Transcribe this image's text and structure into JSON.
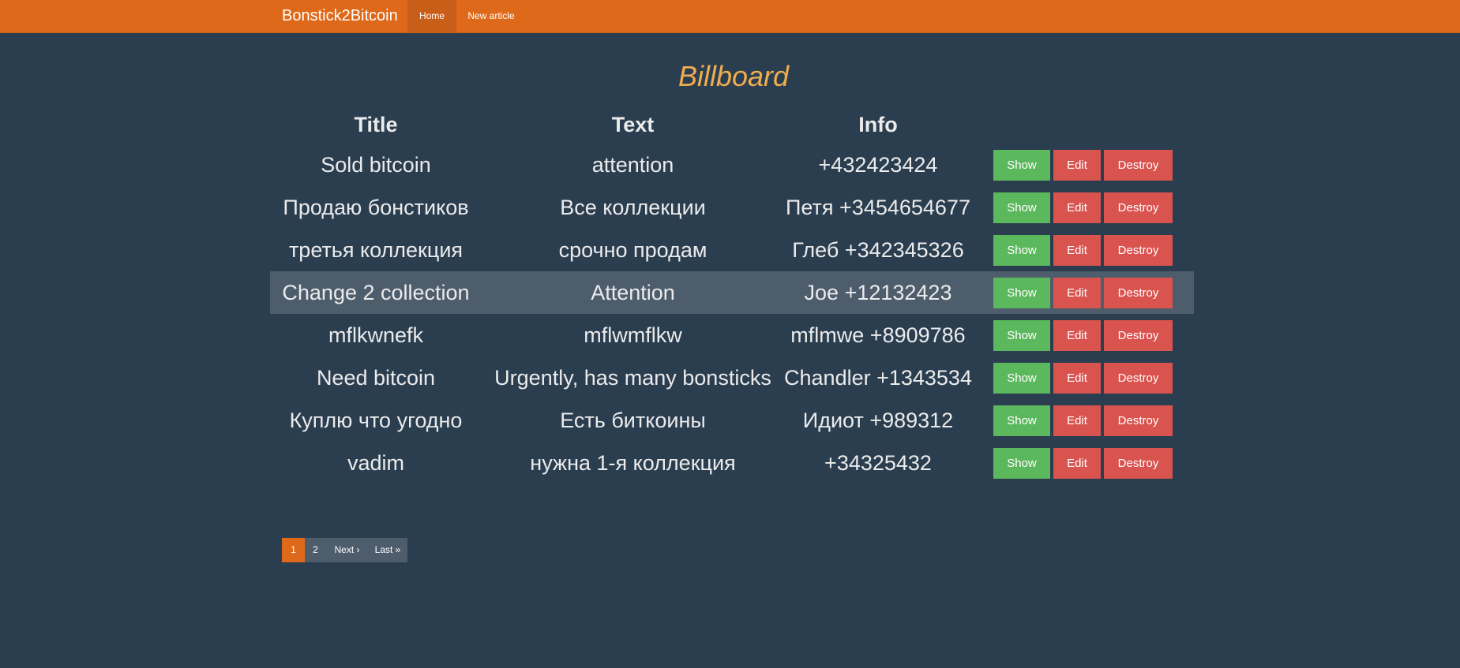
{
  "navbar": {
    "brand": "Bonstick2Bitcoin",
    "items": [
      {
        "label": "Home",
        "active": true
      },
      {
        "label": "New article",
        "active": false
      }
    ],
    "color": "#df691a"
  },
  "page": {
    "heading": "Billboard",
    "heading_color": "#f0ad4e",
    "background": "#2b3e50"
  },
  "table": {
    "headers": {
      "title": "Title",
      "text": "Text",
      "info": "Info"
    },
    "rows": [
      {
        "title": "Sold bitcoin",
        "text": "attention",
        "info": "+432423424",
        "show": "Show",
        "edit": "Edit",
        "destroy": "Destroy"
      },
      {
        "title": "Продаю бонстиков",
        "text": "Все коллекции",
        "info": "Петя +3454654677",
        "show": "Show",
        "edit": "Edit",
        "destroy": "Destroy"
      },
      {
        "title": "третья коллекция",
        "text": "срочно продам",
        "info": "Глеб +342345326",
        "show": "Show",
        "edit": "Edit",
        "destroy": "Destroy"
      },
      {
        "title": "Change 2 collection",
        "text": "Attention",
        "info": "Joe +12132423",
        "show": "Show",
        "edit": "Edit",
        "destroy": "Destroy"
      },
      {
        "title": "mflkwnefk",
        "text": "mflwmflkw",
        "info": "mflmwe +8909786",
        "show": "Show",
        "edit": "Edit",
        "destroy": "Destroy"
      },
      {
        "title": "Need bitcoin",
        "text": "Urgently, has many bonsticks",
        "info": "Chandler +1343534",
        "show": "Show",
        "edit": "Edit",
        "destroy": "Destroy"
      },
      {
        "title": "Куплю что угодно",
        "text": "Есть биткоины",
        "info": "Идиот +989312",
        "show": "Show",
        "edit": "Edit",
        "destroy": "Destroy"
      },
      {
        "title": "vadim",
        "text": "нужна 1-я коллекция",
        "info": "+34325432",
        "show": "Show",
        "edit": "Edit",
        "destroy": "Destroy"
      }
    ],
    "show_color": "#5cb85c",
    "danger_color": "#d9534f"
  },
  "pagination": {
    "pages": [
      {
        "label": "1",
        "active": true
      },
      {
        "label": "2",
        "active": false
      },
      {
        "label": "Next ›",
        "active": false
      },
      {
        "label": "Last »",
        "active": false
      }
    ]
  }
}
